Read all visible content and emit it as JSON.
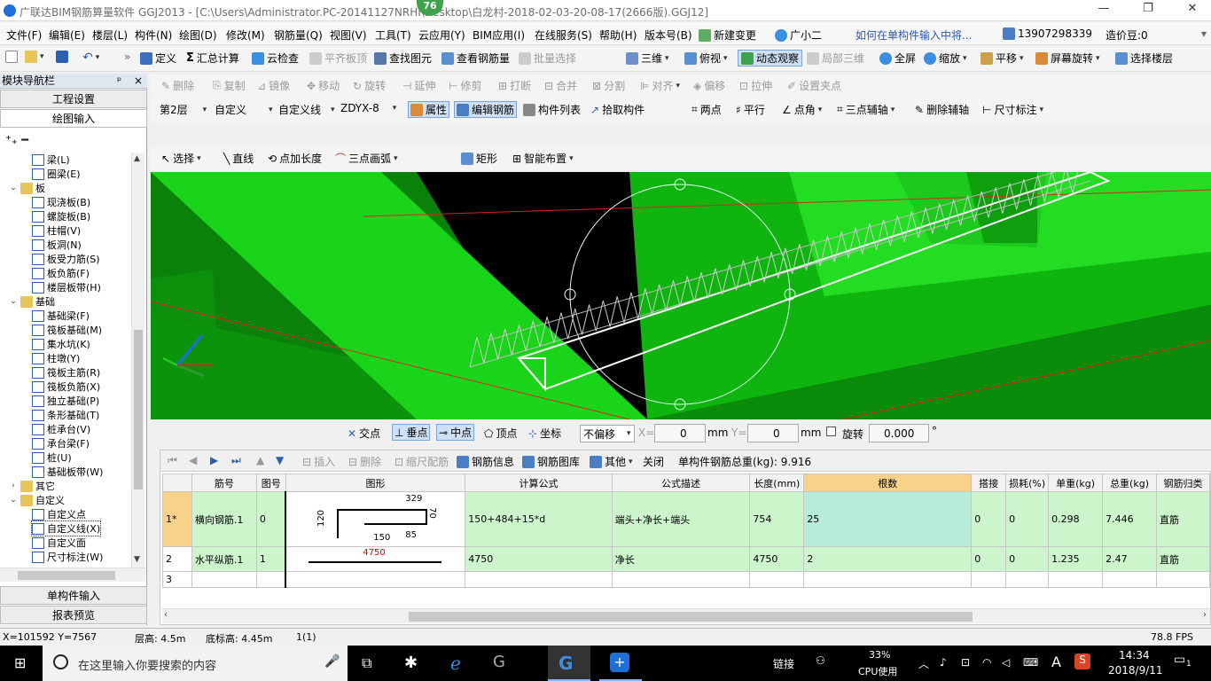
{
  "title": {
    "text": "广联达BIM钢筋算量软件 GGJ2013 - [C:\\Users\\Administrator.PC-20141127NRHI\\Desktop\\白龙村-2018-02-03-20-08-17(2666版).GGJ12]",
    "badge": "76",
    "min": "—",
    "restore": "❐",
    "close": "✕"
  },
  "menubar": {
    "items": [
      "文件(F)",
      "编辑(E)",
      "楼层(L)",
      "构件(N)",
      "绘图(D)",
      "修改(M)",
      "钢筋量(Q)",
      "视图(V)",
      "工具(T)",
      "云应用(Y)",
      "BIM应用(I)",
      "在线服务(S)",
      "帮助(H)",
      "版本号(B)"
    ],
    "new_change": "新建变更",
    "guangxiaoer": "广小二",
    "hint": "如何在单构件输入中将...",
    "phone": "13907298339",
    "price": "造价豆:0"
  },
  "toolbar1": {
    "items": [
      "定义",
      "汇总计算",
      "云检查",
      "平齐板顶",
      "查找图元",
      "查看钢筋量",
      "批量选择",
      "三维",
      "俯视",
      "动态观察",
      "局部三维",
      "全屏",
      "缩放",
      "平移",
      "屏幕旋转",
      "选择楼层"
    ]
  },
  "toolbar2": {
    "items": [
      "删除",
      "复制",
      "镜像",
      "移动",
      "旋转",
      "延伸",
      "修剪",
      "打断",
      "合并",
      "分割",
      "对齐",
      "偏移",
      "拉伸",
      "设置夹点"
    ]
  },
  "toolbar3": {
    "floor": "第2层",
    "type": "自定义",
    "subtype": "自定义线",
    "name": "ZDYX-8",
    "items": [
      "属性",
      "编辑钢筋",
      "构件列表",
      "拾取构件",
      "两点",
      "平行",
      "点角",
      "三点辅轴",
      "删除辅轴",
      "尺寸标注"
    ]
  },
  "toolbar4": {
    "items": [
      "选择",
      "直线",
      "点加长度",
      "三点画弧",
      "矩形",
      "智能布置"
    ]
  },
  "sidebar": {
    "header": "模块导航栏",
    "pin": "ᵖ",
    "close": "×",
    "btn1": "工程设置",
    "btn2": "绘图输入",
    "btn3": "单构件输入",
    "btn4": "报表预览",
    "tree": [
      {
        "label": "梁(L)",
        "level": 2
      },
      {
        "label": "圈梁(E)",
        "level": 2
      },
      {
        "label": "板",
        "level": 1,
        "folder": true
      },
      {
        "label": "现浇板(B)",
        "level": 2
      },
      {
        "label": "螺旋板(B)",
        "level": 2
      },
      {
        "label": "柱帽(V)",
        "level": 2
      },
      {
        "label": "板洞(N)",
        "level": 2
      },
      {
        "label": "板受力筋(S)",
        "level": 2
      },
      {
        "label": "板负筋(F)",
        "level": 2
      },
      {
        "label": "楼层板带(H)",
        "level": 2
      },
      {
        "label": "基础",
        "level": 1,
        "folder": true
      },
      {
        "label": "基础梁(F)",
        "level": 2
      },
      {
        "label": "筏板基础(M)",
        "level": 2
      },
      {
        "label": "集水坑(K)",
        "level": 2
      },
      {
        "label": "柱墩(Y)",
        "level": 2
      },
      {
        "label": "筏板主筋(R)",
        "level": 2
      },
      {
        "label": "筏板负筋(X)",
        "level": 2
      },
      {
        "label": "独立基础(P)",
        "level": 2
      },
      {
        "label": "条形基础(T)",
        "level": 2
      },
      {
        "label": "桩承台(V)",
        "level": 2
      },
      {
        "label": "承台梁(F)",
        "level": 2
      },
      {
        "label": "桩(U)",
        "level": 2
      },
      {
        "label": "基础板带(W)",
        "level": 2
      },
      {
        "label": "其它",
        "level": 1,
        "folder": true,
        "collapsed": true
      },
      {
        "label": "自定义",
        "level": 1,
        "folder": true
      },
      {
        "label": "自定义点",
        "level": 2
      },
      {
        "label": "自定义线(X)",
        "level": 2,
        "selected": true
      },
      {
        "label": "自定义面",
        "level": 2
      },
      {
        "label": "尺寸标注(W)",
        "level": 2
      }
    ]
  },
  "snapbar": {
    "items": [
      "交点",
      "垂点",
      "中点",
      "顶点",
      "坐标"
    ],
    "offset": "不偏移",
    "x_label": "X=",
    "x_value": "0",
    "mm": "mm",
    "y_label": "Y=",
    "y_value": "0",
    "mm2": "mm",
    "rotate": "旋转",
    "rotate_value": "0.000",
    "degree": "°"
  },
  "gridtool": {
    "items": [
      "插入",
      "删除",
      "缩尺配筋",
      "钢筋信息",
      "钢筋图库",
      "其他",
      "关闭"
    ],
    "total": "单构件钢筋总重(kg): 9.916"
  },
  "grid": {
    "headers": [
      "筋号",
      "图号",
      "图形",
      "计算公式",
      "公式描述",
      "长度(mm)",
      "根数",
      "搭接",
      "损耗(%)",
      "单重(kg)",
      "总重(kg)",
      "钢筋归类"
    ],
    "rows": [
      {
        "idx": "1*",
        "name": "横向钢筋.1",
        "fig": "0",
        "formula": "150+484+15*d",
        "desc": "端头+净长+端头",
        "length": "754",
        "count": "25",
        "lap": "0",
        "loss": "0",
        "unit": "0.298",
        "total": "7.446",
        "cat": "直筋",
        "shape": {
          "a": "329",
          "b": "70",
          "c": "120",
          "d": "150",
          "e": "85"
        }
      },
      {
        "idx": "2",
        "name": "水平纵筋.1",
        "fig": "1",
        "formula": "4750",
        "desc": "净长",
        "length": "4750",
        "count": "2",
        "lap": "0",
        "loss": "0",
        "unit": "1.235",
        "total": "2.47",
        "cat": "直筋",
        "shape": {
          "a": "4750"
        }
      },
      {
        "idx": "3",
        "name": "",
        "fig": "",
        "formula": "",
        "desc": "",
        "length": "",
        "count": "",
        "lap": "",
        "loss": "",
        "unit": "",
        "total": "",
        "cat": ""
      }
    ]
  },
  "status": {
    "coords": "X=101592 Y=7567",
    "floor_h": "层高: 4.5m",
    "base_h": "底标高: 4.45m",
    "sel": "1(1)",
    "fps": "78.8 FPS"
  },
  "taskbar": {
    "search": "在这里输入你要搜索的内容",
    "link": "链接",
    "cpu_pct": "33%",
    "cpu_label": "CPU使用",
    "ime": "A",
    "time": "14:34",
    "date": "2018/9/11",
    "notif": "1"
  }
}
